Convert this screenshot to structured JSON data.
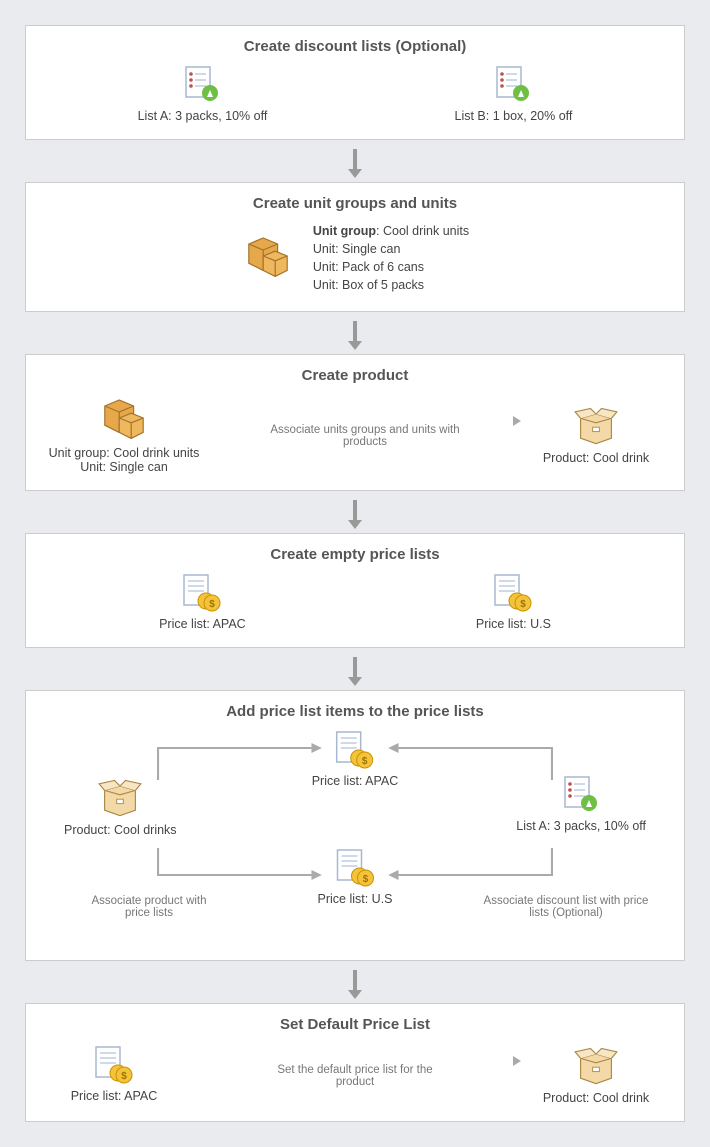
{
  "step1": {
    "title": "Create discount lists (Optional)",
    "listA": "List A: 3 packs, 10% off",
    "listB": "List B: 1 box, 20% off"
  },
  "step2": {
    "title": "Create unit groups and units",
    "groupLabel": "Unit group",
    "groupName": ": Cool drink units",
    "u1": "Unit: Single can",
    "u2": "Unit: Pack of 6 cans",
    "u3": "Unit: Box of 5 packs"
  },
  "step3": {
    "title": "Create product",
    "leftL1": "Unit group: Cool drink units",
    "leftL2": "Unit: Single can",
    "arrow": "Associate units groups and units with products",
    "right": "Product: Cool drink"
  },
  "step4": {
    "title": "Create empty price lists",
    "apac": "Price list: APAC",
    "us": "Price list: U.S"
  },
  "step5": {
    "title": "Add price list items to the price lists",
    "product": "Product: Cool drinks",
    "apac": "Price list: APAC",
    "us": "Price list: U.S",
    "list": "List A: 3 packs, 10% off",
    "leftNote": "Associate product with price lists",
    "rightNote": "Associate discount list with price lists (Optional)"
  },
  "step6": {
    "title": "Set Default Price List",
    "left": "Price list: APAC",
    "arrow": "Set the default price list for the product",
    "right": "Product: Cool drink"
  }
}
